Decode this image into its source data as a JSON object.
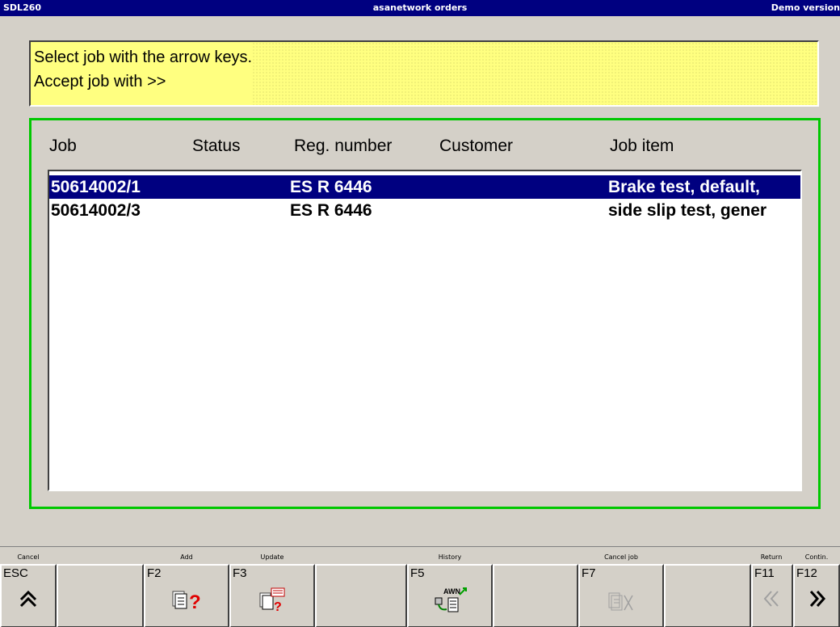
{
  "titlebar": {
    "left": "SDL260",
    "center": "asanetwork orders",
    "right": "Demo version"
  },
  "instructions": {
    "line1": "Select job with the arrow keys.",
    "line2": "Accept job with >>"
  },
  "table": {
    "columns": [
      "Job",
      "Status",
      "Reg. number",
      "Customer",
      "Job item"
    ],
    "rows": [
      {
        "job": "50614002/1",
        "status": "",
        "reg": "ES R 6446",
        "customer": "",
        "item": "Brake test, default, ",
        "selected": true
      },
      {
        "job": "50614002/3",
        "status": "",
        "reg": "ES R 6446",
        "customer": "",
        "item": "side slip test, gener",
        "selected": false
      }
    ]
  },
  "fkeys": {
    "esc": {
      "key": "ESC",
      "label": "Cancel",
      "icon": "double-chevron-up-icon"
    },
    "f2": {
      "key": "F2",
      "label": "Add",
      "icon": "document-question-icon"
    },
    "f3": {
      "key": "F3",
      "label": "Update",
      "icon": "test-document-question-icon"
    },
    "f5": {
      "key": "F5",
      "label": "History",
      "icon": "awn-history-icon",
      "awn": "AWN"
    },
    "f7": {
      "key": "F7",
      "label": "Cancel job",
      "icon": "document-cancel-icon"
    },
    "f11": {
      "key": "F11",
      "label": "Return",
      "icon": "double-chevron-left-icon"
    },
    "f12": {
      "key": "F12",
      "label": "Contin.",
      "icon": "double-chevron-right-icon"
    }
  },
  "colors": {
    "title_bg": "#000080",
    "selection_bg": "#000080",
    "panel_yellow": "#ffff80",
    "frame_green": "#00c800",
    "question_red": "#e00000"
  }
}
